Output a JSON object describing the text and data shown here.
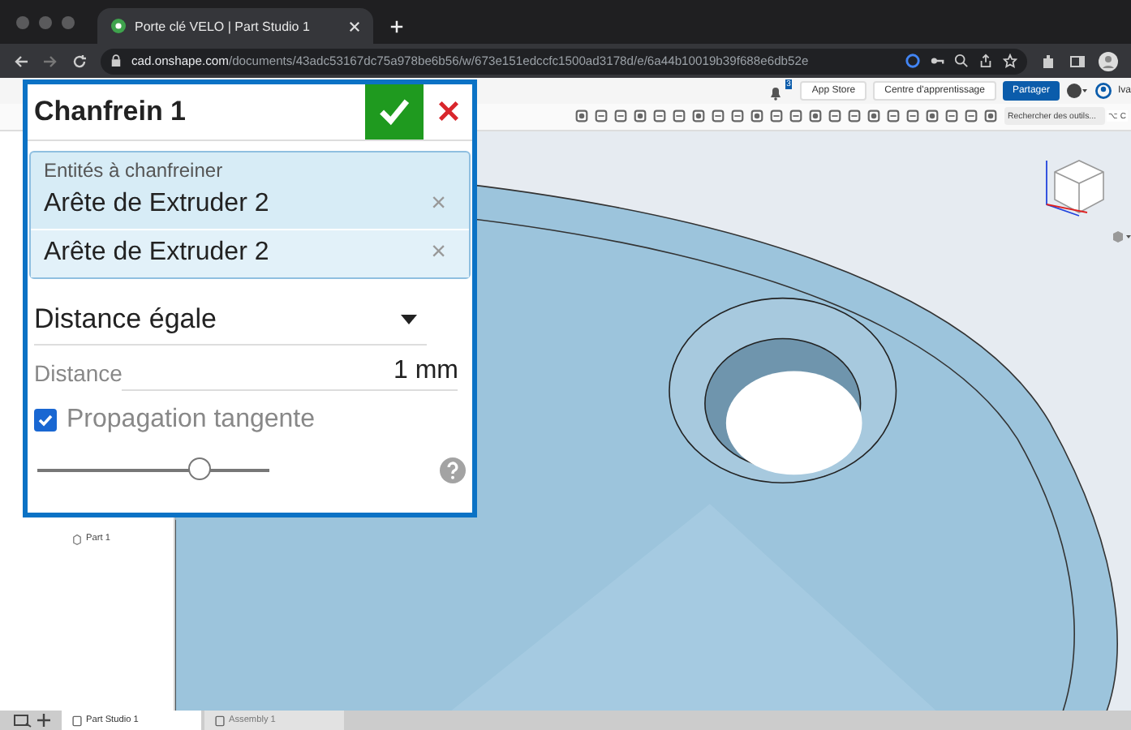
{
  "browser": {
    "tab_title": "Porte clé VELO | Part Studio 1",
    "url_host": "cad.onshape.com",
    "url_path": "/documents/43adc53167dc75a978be6b56/w/673e151edccfc1500ad3178d/e/6a44b10019b39f688e6db52e"
  },
  "header": {
    "notification_count": "3",
    "buttons": [
      "App Store",
      "Centre d'apprentissage"
    ],
    "share_button": "Partager",
    "user_name": "Iva"
  },
  "toolbar": {
    "search_placeholder": "Rechercher des outils...",
    "shortcut": "⌥ C"
  },
  "feature_tree": {
    "items": [
      {
        "label": "Part 1"
      }
    ]
  },
  "dialog": {
    "title": "Chanfrein 1",
    "selection_label": "Entités à chanfreiner",
    "selections": [
      {
        "label": "Arête de Extruder 2"
      },
      {
        "label": "Arête de Extruder 2"
      }
    ],
    "remove_glyph": "×",
    "type_dropdown": "Distance égale",
    "distance_label": "Distance",
    "distance_value": "1 mm",
    "tangent_propagation": {
      "label": "Propagation tangente",
      "checked": true
    },
    "slider": {
      "level": 0.7
    }
  },
  "bottom_tabs": [
    {
      "label": "Part Studio 1",
      "selected": true
    },
    {
      "label": "Assembly 1",
      "selected": false
    }
  ]
}
